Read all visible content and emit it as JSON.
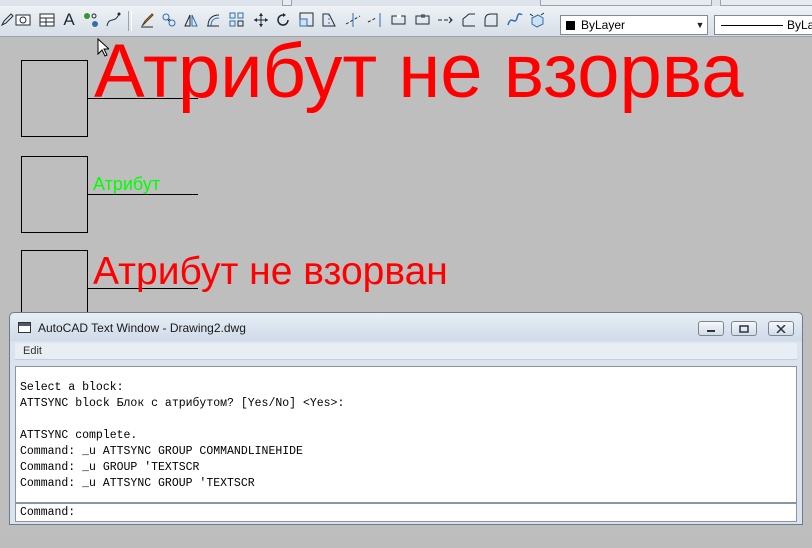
{
  "toolbar": {
    "icons": [
      "pencil-icon",
      "table-icon",
      "text-icon",
      "attribute-definition-icon",
      "edit-polyline-icon",
      "paintbrush-icon",
      "move-icon",
      "mirror-icon",
      "offset-icon",
      "array-icon",
      "pan-icon",
      "rotate-icon",
      "scale-icon",
      "stretch-icon",
      "trim-icon",
      "extend-icon",
      "break-icon",
      "join-icon",
      "chamfer-icon",
      "fillet-icon",
      "spline-icon",
      "explode-icon"
    ],
    "layer": "ByLayer",
    "linetype": "ByLa"
  },
  "drawing": {
    "blocks": [
      {
        "attribute_text": "Атрибут не взорва",
        "color": "#ff0000"
      },
      {
        "attribute_text": "Атрибут",
        "color": "#00ff00"
      },
      {
        "attribute_text": "Атрибут не взорван",
        "color": "#ff0000"
      }
    ]
  },
  "text_window": {
    "title": "AutoCAD Text Window - Drawing2.dwg",
    "menu": {
      "edit": "Edit"
    },
    "lines": [
      "Select a block:",
      "ATTSYNC block Блок с атрибутом? [Yes/No] <Yes>:",
      "",
      "ATTSYNC complete.",
      "Command: _u ATTSYNC GROUP COMMANDLINEHIDE",
      "Command: _u GROUP 'TEXTSCR",
      "Command: _u ATTSYNC GROUP 'TEXTSCR"
    ],
    "command_prompt": "Command:"
  }
}
